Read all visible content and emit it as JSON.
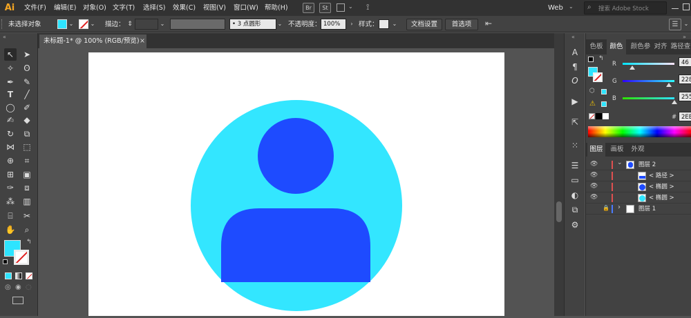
{
  "app": {
    "logo": "Ai"
  },
  "menu": [
    "文件(F)",
    "编辑(E)",
    "对象(O)",
    "文字(T)",
    "选择(S)",
    "效果(C)",
    "视图(V)",
    "窗口(W)",
    "帮助(H)"
  ],
  "bridge": {
    "br": "Br",
    "st": "St"
  },
  "workspace": "Web",
  "search_placeholder": "搜索 Adobe Stock",
  "control": {
    "selection": "未选择对象",
    "stroke_label": "描边：",
    "stroke_profile": "3 点圆形",
    "opacity_label": "不透明度：",
    "opacity_value": "100%",
    "style_label": "样式：",
    "doc_setup": "文档设置",
    "prefs": "首选项"
  },
  "document_tab": {
    "title": "未标题-1* @ 100% (RGB/预览)",
    "close": "×"
  },
  "color_panel": {
    "tabs": [
      "色板",
      "颜色",
      "颜色参",
      "对齐",
      "路径查"
    ],
    "r_label": "R",
    "r_value": "46",
    "g_label": "G",
    "g_value": "228",
    "b_label": "B",
    "b_value": "255",
    "hex_prefix": "#",
    "hex_value": "2EE4FF",
    "r_level": 0.18,
    "g_level": 0.894,
    "b_level": 1.0
  },
  "layers_panel": {
    "tabs": [
      "图层",
      "画板",
      "外观"
    ],
    "rows": [
      {
        "name": "图层 2",
        "expand": "⌄"
      },
      {
        "name": "< 路径 >"
      },
      {
        "name": "< 椭圆 >"
      },
      {
        "name": "< 椭圆 >"
      },
      {
        "name": "图层 1",
        "expand": "›"
      }
    ]
  },
  "colors": {
    "fill": "#2EE4FF",
    "person": "#1E4BFF",
    "circle": "#33E6FF"
  }
}
